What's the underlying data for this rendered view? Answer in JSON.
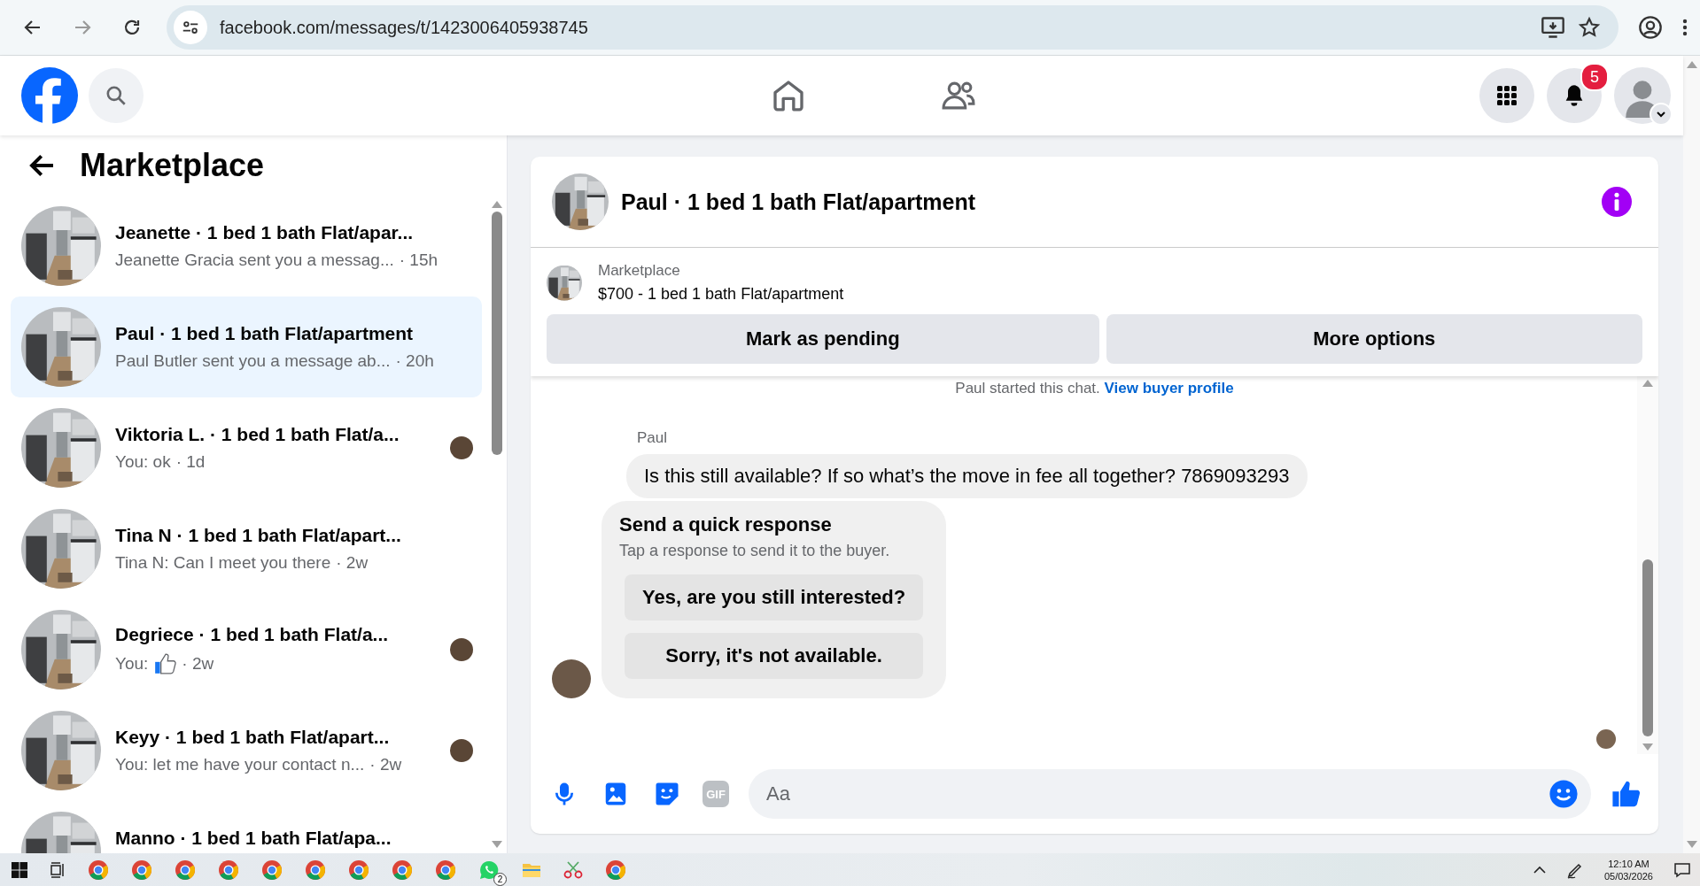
{
  "browser": {
    "url": "facebook.com/messages/t/1423006405938745"
  },
  "topbar": {
    "notification_count": "5"
  },
  "sidebar": {
    "title": "Marketplace",
    "conversations": [
      {
        "title": "Jeanette · 1 bed 1 bath Flat/apar...",
        "preview": "Jeanette Gracia sent you a messag...",
        "time": "· 15h",
        "kind": "text",
        "selected": false,
        "seen": false
      },
      {
        "title": "Paul · 1 bed 1 bath Flat/apartment",
        "preview": "Paul Butler sent you a message ab...",
        "time": "· 20h",
        "kind": "text",
        "selected": true,
        "seen": false
      },
      {
        "title": "Viktoria L. · 1 bed 1 bath Flat/a...",
        "preview": "You: ok",
        "time": "· 1d",
        "kind": "text",
        "selected": false,
        "seen": true
      },
      {
        "title": "Tina N · 1 bed 1 bath Flat/apart...",
        "preview": "Tina N: Can I meet you there",
        "time": "· 2w",
        "kind": "text",
        "selected": false,
        "seen": false
      },
      {
        "title": "Degriece · 1 bed 1 bath Flat/a...",
        "preview": "You:",
        "time": "· 2w",
        "kind": "like",
        "selected": false,
        "seen": true
      },
      {
        "title": "Keyy · 1 bed 1 bath Flat/apart...",
        "preview": "You: let me have your contact n...",
        "time": "· 2w",
        "kind": "text",
        "selected": false,
        "seen": true
      },
      {
        "title": "Manno · 1 bed 1 bath Flat/apa...",
        "selected": false,
        "seen": false
      }
    ]
  },
  "chat": {
    "title": "Paul · 1 bed 1 bath Flat/apartment",
    "listing": {
      "label": "Marketplace",
      "title": "$700 - 1 bed 1 bath Flat/apartment"
    },
    "actions": [
      "Mark as pending",
      "More options"
    ],
    "started_text": "Paul started this chat.",
    "started_link": "View buyer profile",
    "messages": [
      {
        "sender": "Paul",
        "text": "Is this still available? If so what’s the move in fee all together? 7869093293"
      }
    ],
    "quick_response": {
      "title": "Send a quick response",
      "subtitle": "Tap a response to send it to the buyer.",
      "options": [
        "Yes, are you still interested?",
        "Sorry, it's not available."
      ]
    },
    "composer": {
      "gif_label": "GIF",
      "placeholder": "Aa"
    }
  },
  "taskbar": {
    "whatsapp_badge": "2",
    "time": "12:10 AM",
    "date": "05/03/2026"
  }
}
